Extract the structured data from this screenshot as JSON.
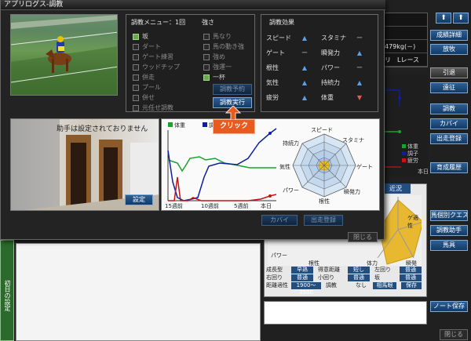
{
  "window": {
    "title": "アプリログス-調教"
  },
  "training_menu": {
    "title": "調教メニュー：1回",
    "strength_title": "強さ",
    "menu_items": [
      {
        "label": "坂",
        "checked": true
      },
      {
        "label": "ダート",
        "checked": false
      },
      {
        "label": "ゲート練習",
        "checked": false
      },
      {
        "label": "ウッドチップ",
        "checked": false
      },
      {
        "label": "併走",
        "checked": false
      },
      {
        "label": "プール",
        "checked": false
      },
      {
        "label": "併せ",
        "checked": false
      },
      {
        "label": "元任せ調教",
        "checked": false
      }
    ],
    "strength_items": [
      {
        "label": "馬なり",
        "checked": false
      },
      {
        "label": "馬の動き強",
        "checked": false
      },
      {
        "label": "強め",
        "checked": false
      },
      {
        "label": "強運一",
        "checked": false
      },
      {
        "label": "一杯",
        "checked": true
      }
    ],
    "reserve_button": "調教予約",
    "execute_button": "調教実行"
  },
  "effects": {
    "title": "調教効果",
    "rows": [
      [
        {
          "label": "スピード",
          "symbol": "▲",
          "tone": "up"
        },
        {
          "label": "スタミナ",
          "symbol": "ー",
          "tone": "flat"
        }
      ],
      [
        {
          "label": "ゲート",
          "symbol": "ー",
          "tone": "flat"
        },
        {
          "label": "瞬発力",
          "symbol": "▲",
          "tone": "up"
        }
      ],
      [
        {
          "label": "根性",
          "symbol": "▲",
          "tone": "up"
        },
        {
          "label": "パワー",
          "symbol": "ー",
          "tone": "flat"
        }
      ],
      [
        {
          "label": "気性",
          "symbol": "▲",
          "tone": "up"
        },
        {
          "label": "持続力",
          "symbol": "▲",
          "tone": "up"
        }
      ],
      [
        {
          "label": "疲労",
          "symbol": "▲",
          "tone": "up"
        },
        {
          "label": "体重",
          "symbol": "▼",
          "tone": "down"
        }
      ]
    ]
  },
  "assistant": {
    "message": "助手は設定されておりません",
    "settings_button": "設定"
  },
  "graph": {
    "legend": [
      "体重",
      "調"
    ],
    "x_ticks": [
      "15週前",
      "10週前",
      "5週前",
      "本日"
    ],
    "radar_labels": [
      "スピード",
      "スタミナ",
      "ゲート",
      "瞬発力",
      "根性",
      "パワー",
      "気性",
      "持続力"
    ]
  },
  "callout": {
    "label": "クリック"
  },
  "dialog_buttons": {
    "cover": "カバイ",
    "race_entry": "出走登録",
    "close": "閉じる"
  },
  "background": {
    "info_rows": [
      "",
      "",
      "479kg(－)",
      "",
      "リ　Lレース"
    ],
    "side_buttons": [
      "成績詳細",
      "放牧",
      "引退",
      "遠征",
      "調教",
      "カバイ",
      "出走登録",
      "育成履歴",
      "馬個別クエスト",
      "調教助手",
      "馬具",
      "ノート保存"
    ],
    "legend": [
      "体重",
      "調子",
      "疲労"
    ],
    "today_label": "本日",
    "horse_tab": "近況",
    "horse_radar_labels": [
      "ゲ適性",
      "パワー",
      "根性",
      "体力",
      "瞬発"
    ],
    "horse_details": [
      {
        "k1": "成長型",
        "v1": "早熟",
        "k2": "得意距離",
        "v2": "短し",
        "k3": "左回り",
        "v3": "普通"
      },
      {
        "k1": "右回り",
        "v1": "普通",
        "k2": "小回り",
        "v2": "普通",
        "k3": "坂",
        "v3": "普通"
      },
      {
        "k1": "距離適性",
        "v1": "1900～3500",
        "k2": "調教",
        "v2": "なし",
        "k3": "",
        "v3": ""
      }
    ],
    "horse_buttons": [
      "相馬眼",
      "保存"
    ],
    "left_tab": "初日の設定",
    "close": "閉じる",
    "up_arrow_1": "⬆",
    "up_arrow_2": "⬆"
  },
  "colors": {
    "blue_button": "#1f4f86",
    "callout": "#e85b20",
    "up": "#5aa0e6",
    "down": "#e65a5a",
    "flat": "#bbbbbb",
    "series_weight": "#1aa12e",
    "series_condition": "#0d1fa0",
    "series_fatigue": "#c41414"
  }
}
